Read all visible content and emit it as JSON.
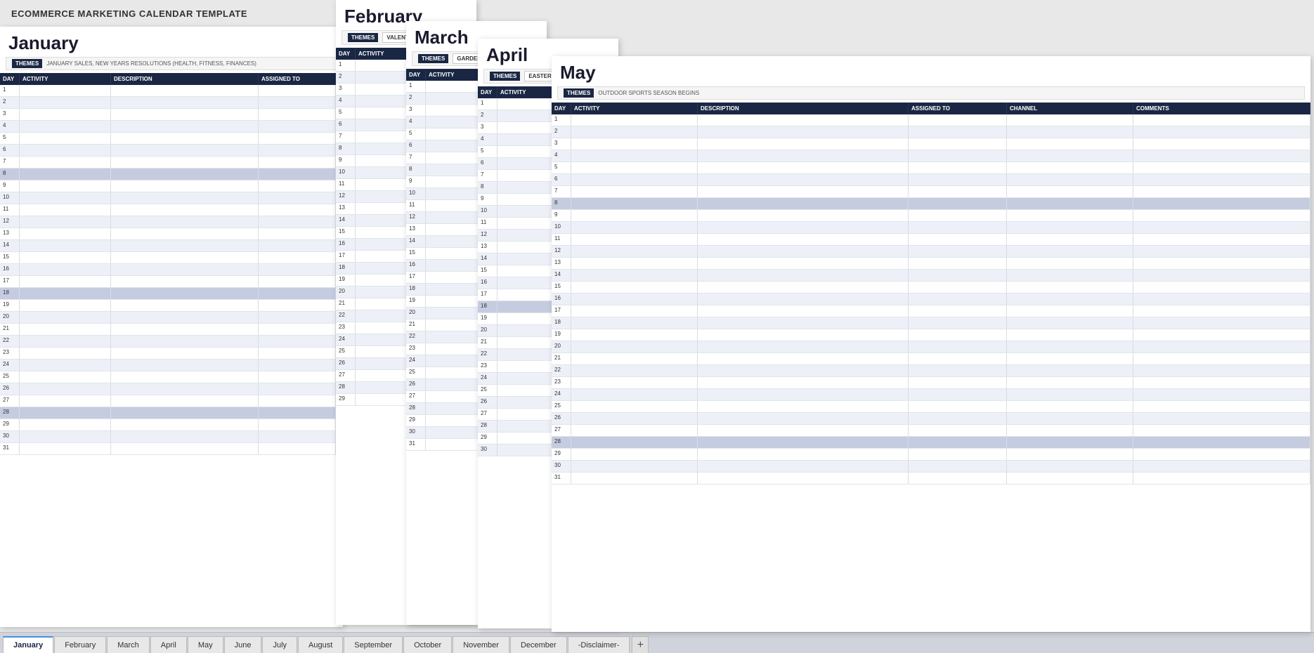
{
  "title": "ECOMMERCE MARKETING CALENDAR TEMPLATE",
  "months": {
    "january": {
      "name": "January",
      "themes_label": "THEMES",
      "themes_text": "JANUARY SALES, NEW YEARS RESOLUTIONS (HEALTH, FITNESS, FINANCES)",
      "columns": [
        "DAY",
        "ACTIVITY",
        "DESCRIPTION",
        "ASSIGNED TO"
      ],
      "days": 31
    },
    "february": {
      "name": "February",
      "themes_label": "THEMES",
      "themes_extra": "VALENTINE",
      "columns": [
        "DAY",
        "ACTIVITY"
      ],
      "days": 29
    },
    "march": {
      "name": "March",
      "themes_label": "THEMES",
      "themes_extra": "GARDENIN...",
      "columns": [
        "DAY",
        "ACTIVITY"
      ],
      "days": 31
    },
    "april": {
      "name": "April",
      "themes_label": "THEMES",
      "themes_extra": "EASTER, WE...",
      "columns": [
        "DAY",
        "ACTIVITY"
      ],
      "days": 30
    },
    "may": {
      "name": "May",
      "themes_label": "THEMES",
      "themes_text": "OUTDOOR SPORTS SEASON BEGINS",
      "columns": [
        "DAY",
        "ACTIVITY",
        "DESCRIPTION",
        "ASSIGNED TO",
        "CHANNEL",
        "COMMENTS"
      ],
      "days": 31
    }
  },
  "tabs": [
    {
      "label": "January",
      "active": true
    },
    {
      "label": "February",
      "active": false
    },
    {
      "label": "March",
      "active": false
    },
    {
      "label": "April",
      "active": false
    },
    {
      "label": "May",
      "active": false
    },
    {
      "label": "June",
      "active": false
    },
    {
      "label": "July",
      "active": false
    },
    {
      "label": "August",
      "active": false
    },
    {
      "label": "September",
      "active": false
    },
    {
      "label": "October",
      "active": false
    },
    {
      "label": "November",
      "active": false
    },
    {
      "label": "December",
      "active": false
    },
    {
      "label": "-Disclaimer-",
      "active": false
    }
  ],
  "colors": {
    "header_bg": "#1a2744",
    "header_text": "#ffffff",
    "row_even": "#edf0f7",
    "row_odd": "#ffffff",
    "highlight": "#c5cce0",
    "title_color": "#1a2744"
  }
}
